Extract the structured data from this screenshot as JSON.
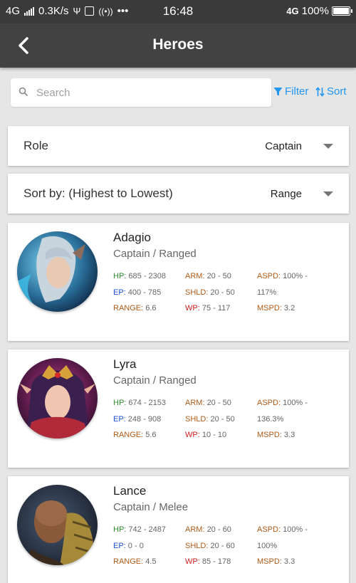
{
  "status_bar": {
    "network": "4G",
    "speed": "0.3K/s",
    "time": "16:48",
    "right_network": "4G",
    "battery": "100%"
  },
  "appbar": {
    "title": "Heroes",
    "back_icon": "chevron-left-icon"
  },
  "search": {
    "placeholder": "Search"
  },
  "toolbar": {
    "filter_label": "Filter",
    "sort_label": "Sort",
    "accent": "#2196f3"
  },
  "role_dropdown": {
    "label": "Role",
    "value": "Captain"
  },
  "sort_dropdown": {
    "label": "Sort by: (Highest to Lowest)",
    "value": "Range"
  },
  "stat_colors": {
    "hp": "#2e8b2e",
    "ep": "#1a4fd1",
    "range": "#b05a16",
    "arm": "#b05a16",
    "shld": "#b05a16",
    "wp": "#cc2020",
    "aspd": "#b05a16",
    "mspd": "#b05a16"
  },
  "heroes": [
    {
      "name": "Adagio",
      "role": "Captain / Ranged",
      "hp": "685 - 2308",
      "ep": "400 - 785",
      "range": "6.6",
      "arm": "20 - 50",
      "shld": "20 - 50",
      "wp": "75 - 117",
      "aspd": "100% -",
      "aspd2": "117%",
      "mspd": "3.2"
    },
    {
      "name": "Lyra",
      "role": "Captain / Ranged",
      "hp": "674 - 2153",
      "ep": "248 - 908",
      "range": "5.6",
      "arm": "20 - 50",
      "shld": "20 - 50",
      "wp": "10 - 10",
      "aspd": "100% -",
      "aspd2": "136.3%",
      "mspd": "3.3"
    },
    {
      "name": "Lance",
      "role": "Captain / Melee",
      "hp": "742 - 2487",
      "ep": "0 - 0",
      "range": "4.5",
      "arm": "20 - 60",
      "shld": "20 - 60",
      "wp": "85 - 178",
      "aspd": "100% -",
      "aspd2": "100%",
      "mspd": "3.3"
    }
  ],
  "stat_labels": {
    "hp": "HP:",
    "ep": "EP:",
    "range": "RANGE:",
    "arm": "ARM:",
    "shld": "SHLD:",
    "wp": "WP:",
    "aspd": "ASPD:",
    "mspd": "MSPD:"
  }
}
